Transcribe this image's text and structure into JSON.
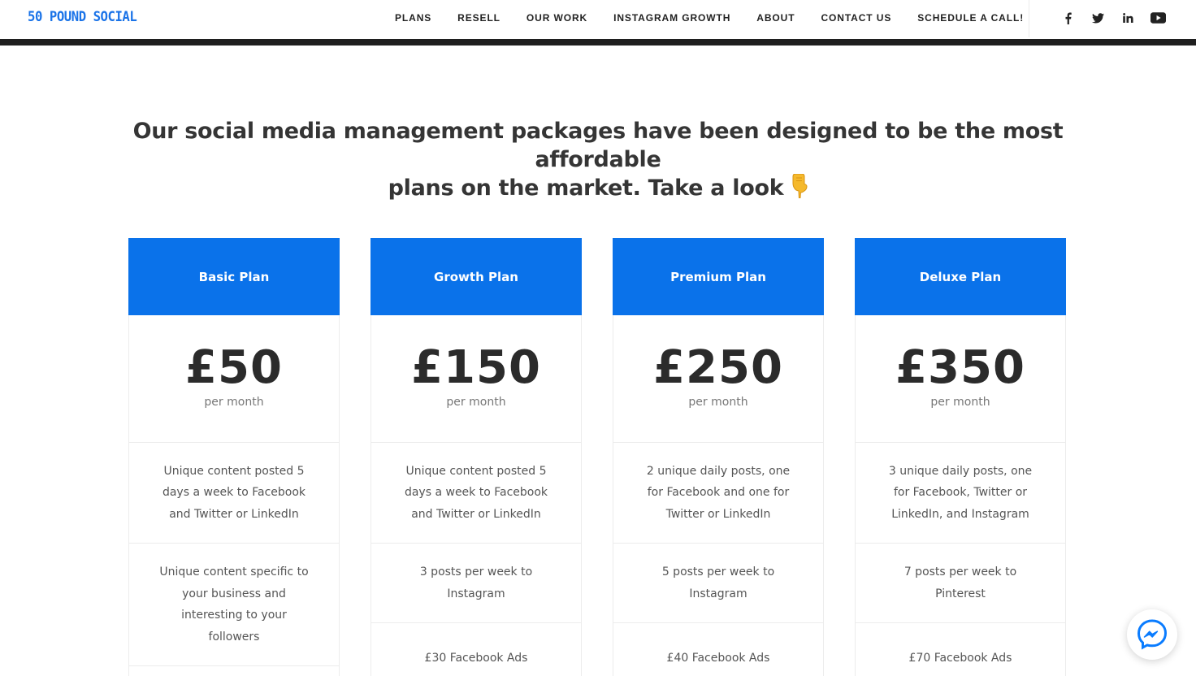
{
  "header": {
    "logo": "50 POUND SOCIAL",
    "nav": [
      "PLANS",
      "RESELL",
      "OUR WORK",
      "INSTAGRAM GROWTH",
      "ABOUT",
      "CONTACT US",
      "SCHEDULE A CALL!"
    ],
    "socials": [
      "facebook-icon",
      "twitter-icon",
      "linkedin-icon",
      "youtube-icon"
    ]
  },
  "hero": {
    "line1": "Our social media management packages have been designed to be the most affordable",
    "line2": "plans on the market. Take a look",
    "emoji": "pointing-down-hand-emoji"
  },
  "colors": {
    "brand_blue": "#0a72ea",
    "logo_blue": "#1a73e8",
    "dark": "#1f1f1f",
    "messenger_blue": "#0a7cff"
  },
  "plans": [
    {
      "name": "Basic Plan",
      "price": "£50",
      "period": "per month",
      "features": [
        "Unique content posted 5 days a week to Facebook and Twitter or LinkedIn",
        "Unique content specific to your business and interesting to your followers"
      ]
    },
    {
      "name": "Growth Plan",
      "price": "£150",
      "period": "per month",
      "features": [
        "Unique content posted 5 days a week to Facebook and Twitter or LinkedIn",
        "3 posts per week to Instagram",
        "£30 Facebook Ads"
      ]
    },
    {
      "name": "Premium Plan",
      "price": "£250",
      "period": "per month",
      "features": [
        "2 unique daily posts, one for Facebook and one for Twitter or LinkedIn",
        "5 posts per week to Instagram",
        "£40 Facebook Ads"
      ]
    },
    {
      "name": "Deluxe Plan",
      "price": "£350",
      "period": "per month",
      "features": [
        "3 unique daily posts, one for Facebook, Twitter or LinkedIn, and Instagram",
        "7 posts per week to Pinterest",
        "£70 Facebook Ads"
      ]
    }
  ],
  "chat": {
    "icon": "messenger-icon"
  }
}
